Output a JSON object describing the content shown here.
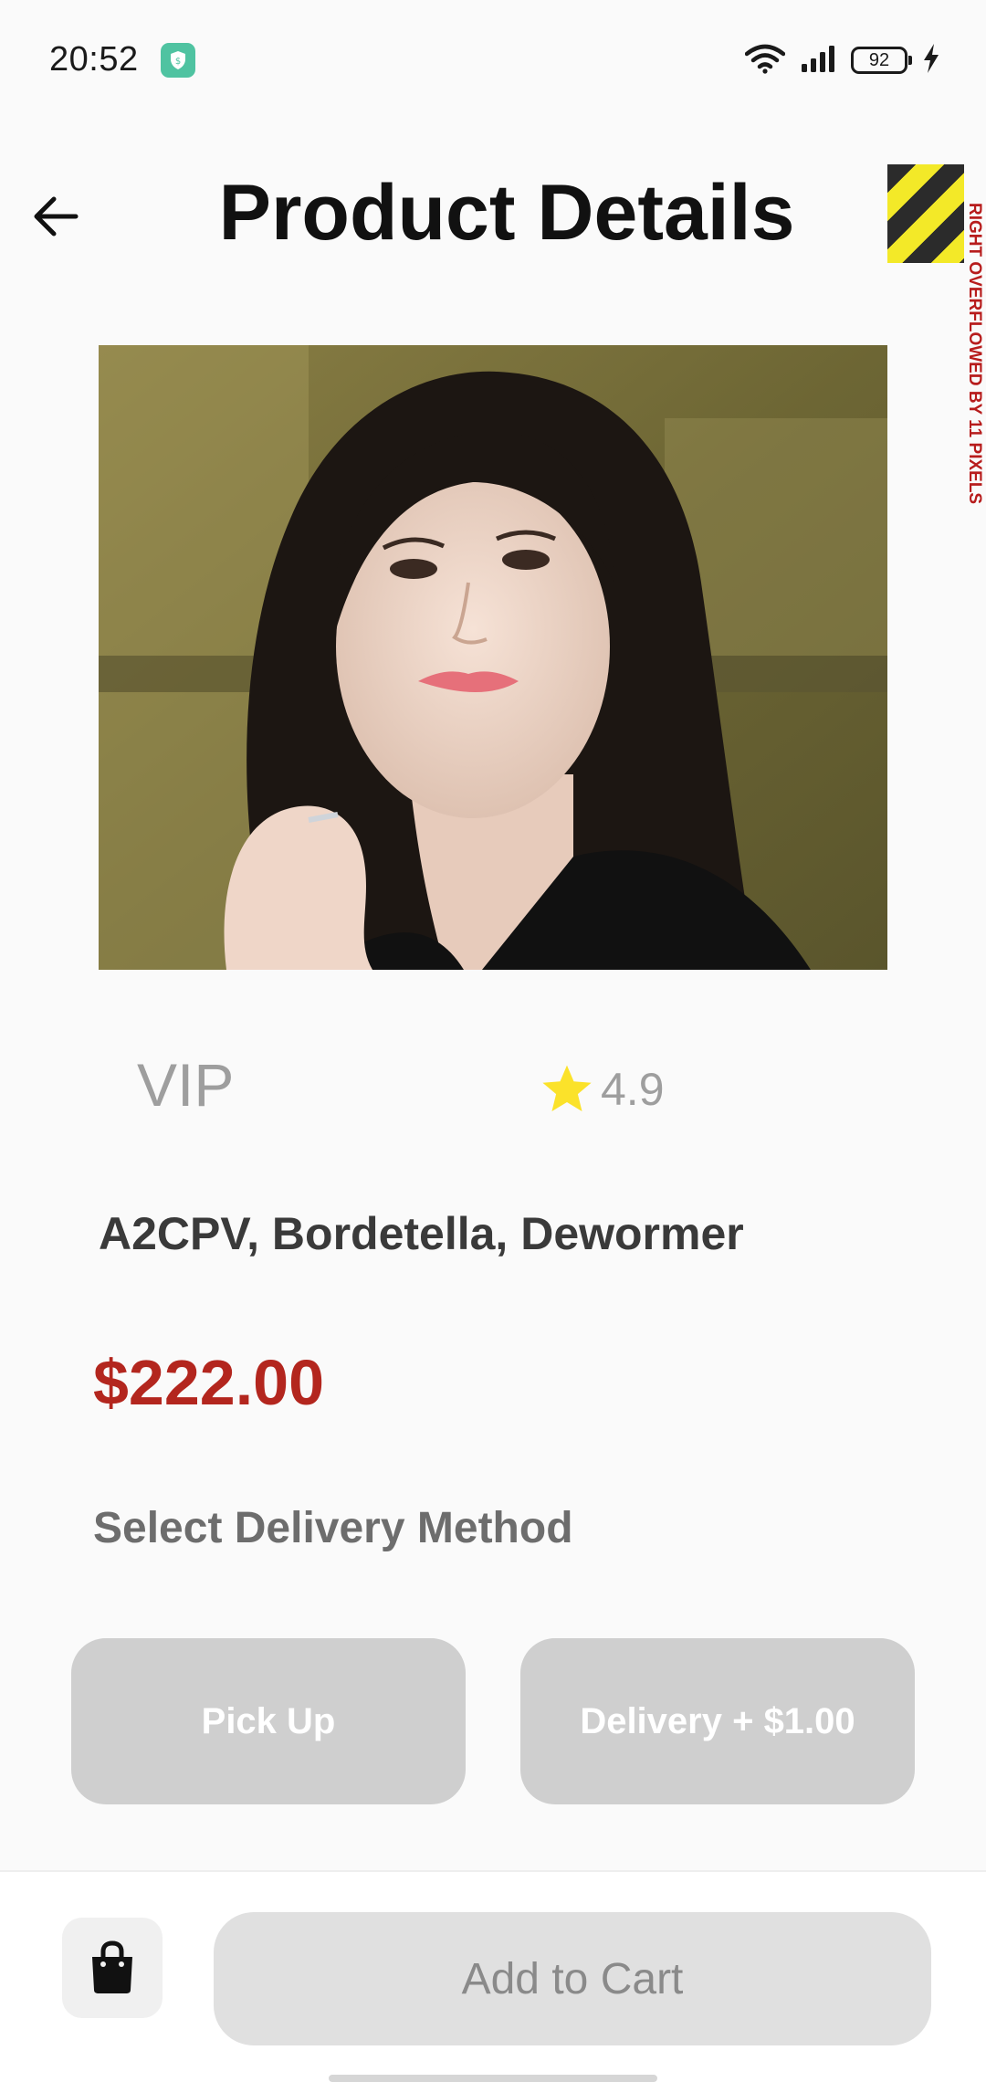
{
  "status_bar": {
    "time": "20:52",
    "battery": "92",
    "icons": [
      "shield-app-icon",
      "wifi-icon",
      "cellular-signal-icon",
      "battery-icon",
      "charging-bolt-icon"
    ]
  },
  "app_bar": {
    "title": "Product Details",
    "back_icon": "arrow-left-icon",
    "overflow_warning": "RIGHT OVERFLOWED BY 11 PIXELS"
  },
  "product": {
    "image_icon": "product-photo",
    "tier": "VIP",
    "rating": "4.9",
    "rating_icon": "star-icon",
    "name": "A2CPV, Bordetella, Dewormer",
    "price": "$222.00"
  },
  "delivery": {
    "heading": "Select Delivery Method",
    "options": [
      {
        "label": "Pick Up"
      },
      {
        "label": "Delivery + $1.00"
      }
    ]
  },
  "bottom_bar": {
    "bag_icon": "shopping-bag-icon",
    "add_to_cart_label": "Add to Cart"
  },
  "colors": {
    "background": "#fafafa",
    "price": "#b3261e",
    "star": "#fbe22a",
    "option_button": "#cfcfcf",
    "cart_button": "#e0e0e0"
  }
}
